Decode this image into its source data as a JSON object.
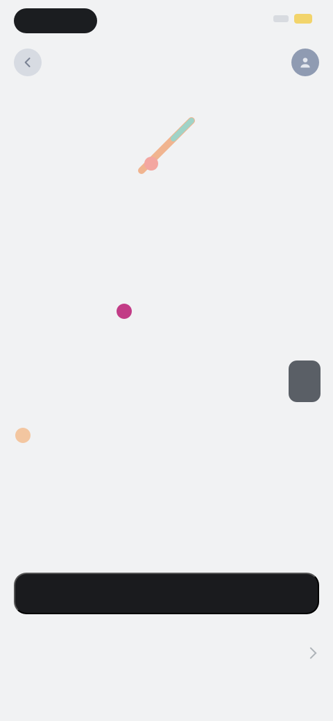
{
  "status_bar": {
    "time": "",
    "battery_color": "#f2d46b"
  },
  "browser": {
    "url": ""
  },
  "header": {
    "back_icon": "chevron-left-icon",
    "user_icon": "user-icon"
  },
  "product": {
    "title": "",
    "meta_left": "",
    "meta_right": "",
    "note": "",
    "info_1": "",
    "info_2": "",
    "info_3": ""
  },
  "stats": [
    {
      "label": "",
      "value": ""
    },
    {
      "label": "",
      "value": ""
    },
    {
      "label": "",
      "value": ""
    }
  ],
  "primary_button": {
    "label": ""
  },
  "details_row": {
    "label": ""
  },
  "section": {
    "title": ""
  },
  "colors": {
    "accent": "#c23c86",
    "primary": "#1a1b1e"
  }
}
